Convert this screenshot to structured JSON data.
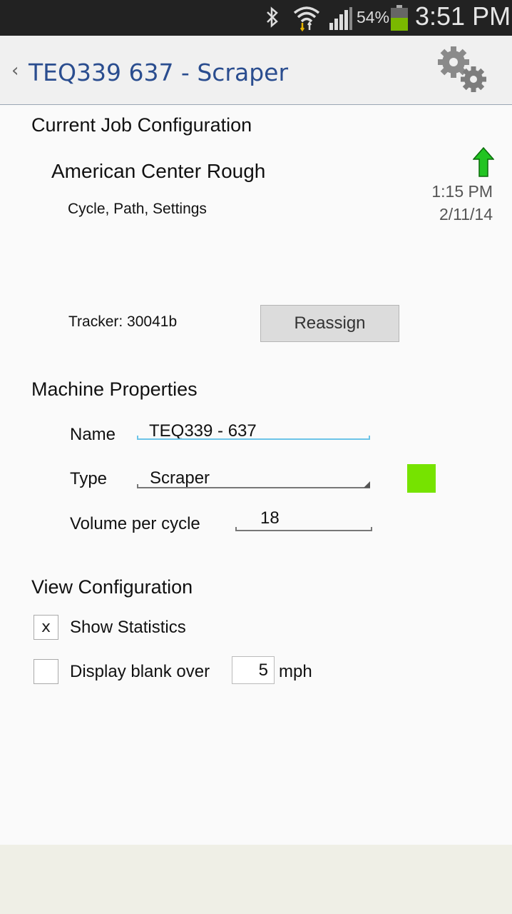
{
  "status_bar": {
    "battery_percent": "54%",
    "time": "3:51 PM",
    "icons": [
      "bluetooth-icon",
      "wifi-icon",
      "signal-icon",
      "battery-icon"
    ]
  },
  "action_bar": {
    "title": "TEQ339 637 - Scraper",
    "back_icon": "chevron-left-icon",
    "settings_icon": "gears-icon"
  },
  "job": {
    "section_title": "Current Job Configuration",
    "name": "American Center Rough",
    "subtitle": "Cycle, Path, Settings",
    "time": "1:15 PM",
    "date": "2/11/14",
    "tracker": "Tracker: 30041b",
    "reassign_label": "Reassign"
  },
  "machine": {
    "section_title": "Machine Properties",
    "name_label": "Name",
    "name_value": "TEQ339 - 637",
    "type_label": "Type",
    "type_value": "Scraper",
    "type_color": "#76e300",
    "volume_label": "Volume per cycle",
    "volume_value": "18"
  },
  "view": {
    "section_title": "View Configuration",
    "show_statistics_label": "Show Statistics",
    "show_statistics_mark": "x",
    "display_blank_label": "Display blank over",
    "display_blank_value": "5",
    "display_blank_unit": "mph"
  },
  "colors": {
    "title_blue": "#2a4d8f",
    "arrow_green": "#22c422",
    "input_active": "#6cc4e8"
  }
}
